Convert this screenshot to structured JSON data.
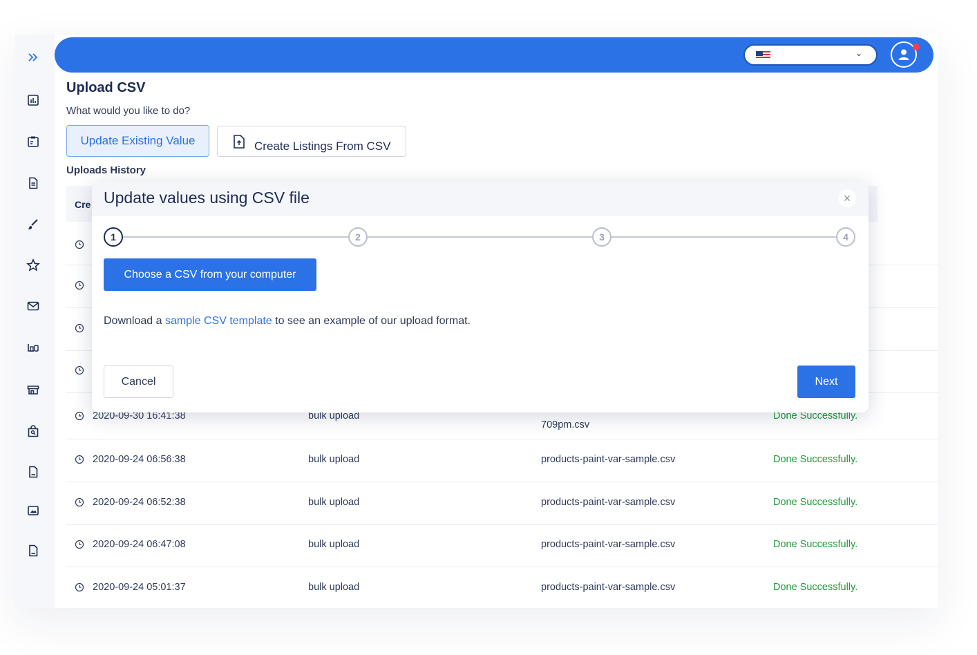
{
  "colors": {
    "accent": "#2b72e6",
    "success": "#1f9b38",
    "text": "#1d2a52",
    "notify": "#ff3b57"
  },
  "sidebar": {
    "icons": [
      "expand-icon",
      "analytics-icon",
      "clipboard-icon",
      "document-icon",
      "brush-icon",
      "star-icon",
      "mail-icon",
      "devices-icon",
      "store-icon",
      "bag-search-icon",
      "pdf-icon",
      "image-icon",
      "csv-file-icon"
    ]
  },
  "header": {
    "language_value": "",
    "language_flag": "us-flag-icon"
  },
  "page": {
    "title": "Upload CSV",
    "subtitle": "What would you like to do?",
    "update_button": "Update Existing Value",
    "create_button": "Create Listings From CSV",
    "history_title": "Uploads History",
    "table_header_partial": "Cre"
  },
  "rows": [
    {
      "date": "2020-09-30 16:41:38",
      "type": "bulk upload",
      "file": "709pm.csv",
      "status": "Done Successfully."
    },
    {
      "date": "2020-09-24 06:56:38",
      "type": "bulk upload",
      "file": "products-paint-var-sample.csv",
      "status": "Done Successfully."
    },
    {
      "date": "2020-09-24 06:52:38",
      "type": "bulk upload",
      "file": "products-paint-var-sample.csv",
      "status": "Done Successfully."
    },
    {
      "date": "2020-09-24 06:47:08",
      "type": "bulk upload",
      "file": "products-paint-var-sample.csv",
      "status": "Done Successfully."
    },
    {
      "date": "2020-09-24 05:01:37",
      "type": "bulk upload",
      "file": "products-paint-var-sample.csv",
      "status": "Done Successfully."
    }
  ],
  "modal": {
    "title": "Update values using CSV file",
    "close": "×",
    "steps": [
      "1",
      "2",
      "3",
      "4"
    ],
    "active_step": "1",
    "choose_button": "Choose a CSV from your computer",
    "download_prefix": "Download a",
    "download_link": "sample CSV template",
    "download_suffix": "to see an example of our upload format.",
    "cancel_button": "Cancel",
    "next_button": "Next"
  }
}
